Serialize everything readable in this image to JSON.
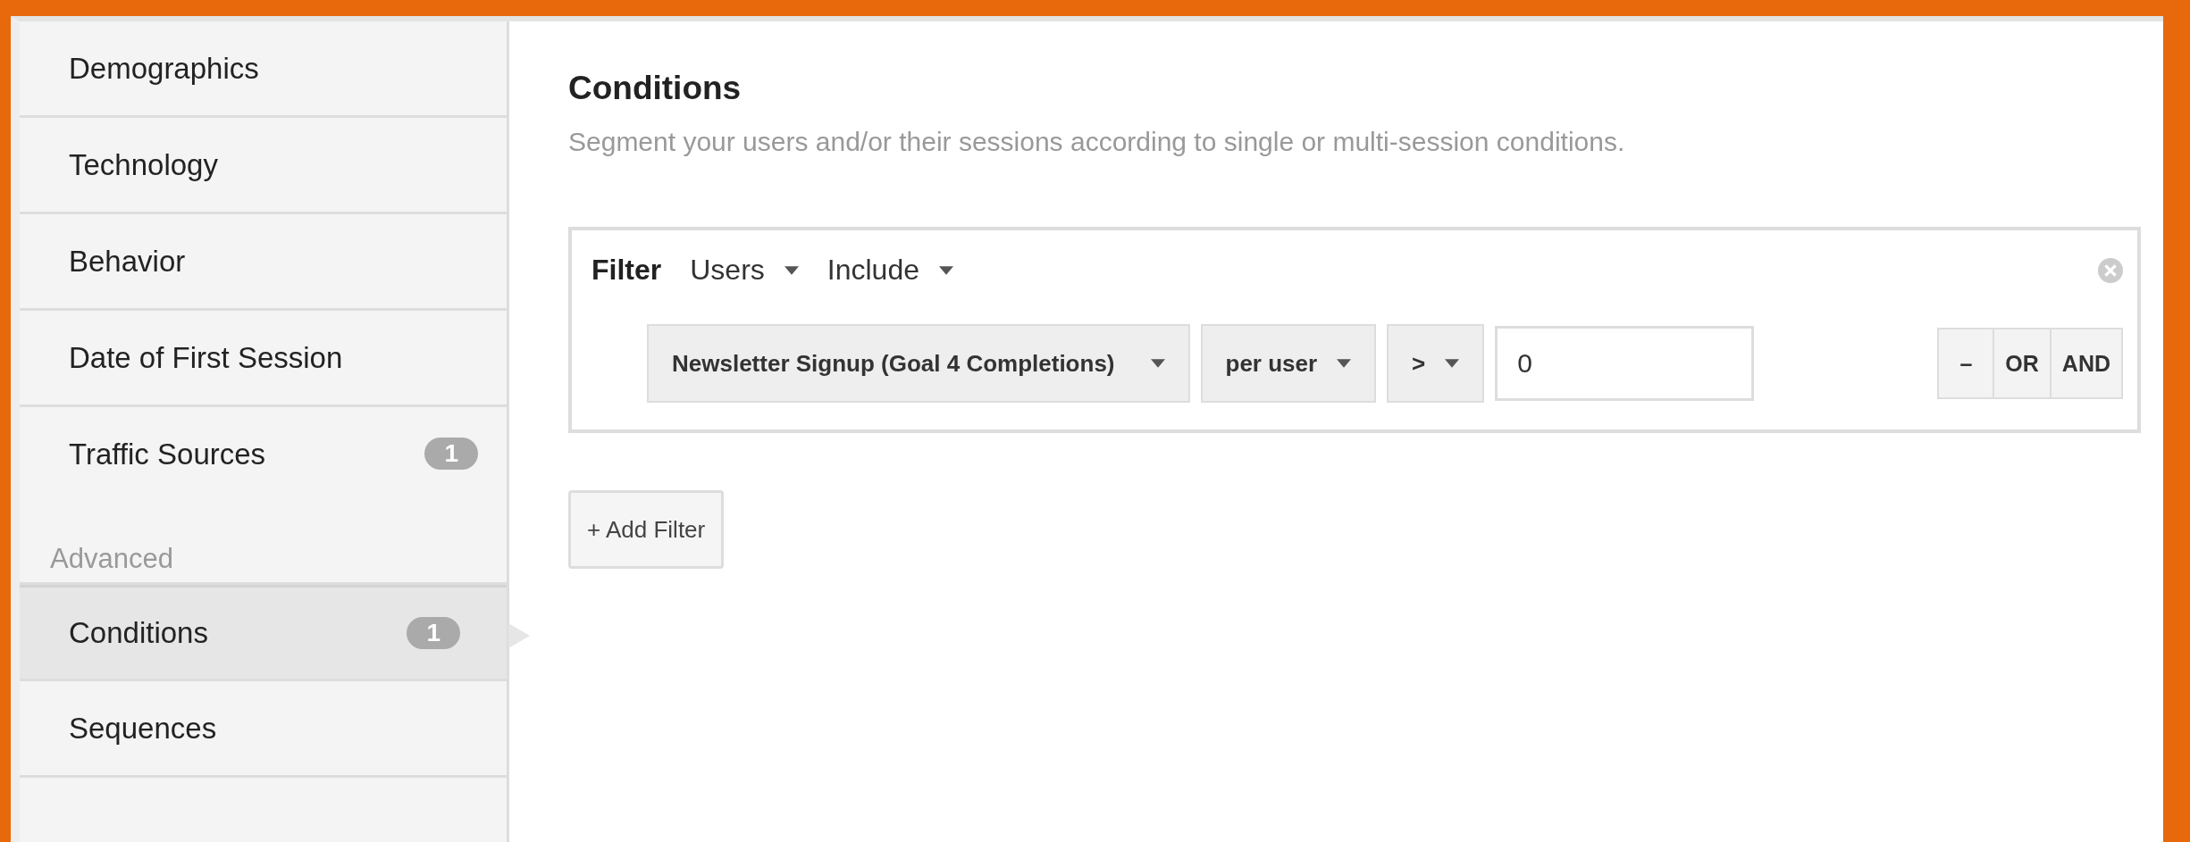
{
  "sidebar": {
    "items": [
      {
        "label": "Demographics",
        "selected": false
      },
      {
        "label": "Technology",
        "selected": false
      },
      {
        "label": "Behavior",
        "selected": false
      },
      {
        "label": "Date of First Session",
        "selected": false
      },
      {
        "label": "Traffic Sources",
        "badge": "1",
        "selected": false
      }
    ],
    "section_label": "Advanced",
    "advanced_items": [
      {
        "label": "Conditions",
        "badge": "1",
        "selected": true
      },
      {
        "label": "Sequences",
        "selected": false
      }
    ]
  },
  "main": {
    "title": "Conditions",
    "subtitle": "Segment your users and/or their sessions according to single or multi-session conditions.",
    "filter": {
      "label": "Filter",
      "scope": "Users",
      "mode": "Include",
      "condition": {
        "metric": "Newsletter Signup (Goal 4 Completions)",
        "per": "per user",
        "operator": ">",
        "value": "0"
      },
      "logic_buttons": [
        "–",
        "OR",
        "AND"
      ]
    },
    "add_filter": "+ Add Filter"
  }
}
